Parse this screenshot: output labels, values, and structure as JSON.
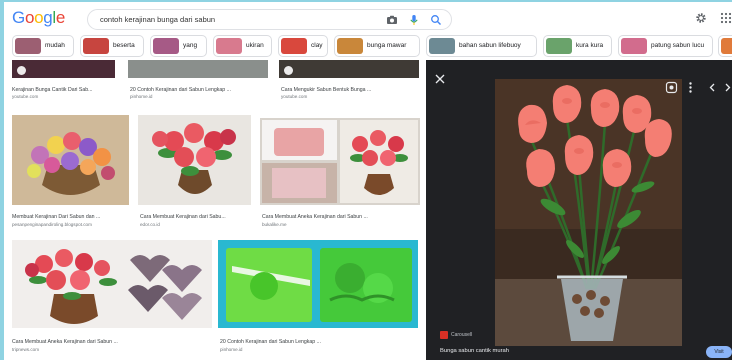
{
  "header": {
    "logo_letters": [
      {
        "ch": "G",
        "color": "#4285f4"
      },
      {
        "ch": "o",
        "color": "#ea4335"
      },
      {
        "ch": "o",
        "color": "#fbbc05"
      },
      {
        "ch": "g",
        "color": "#4285f4"
      },
      {
        "ch": "l",
        "color": "#34a853"
      },
      {
        "ch": "e",
        "color": "#ea4335"
      }
    ],
    "search_value": "contoh kerajinan bunga dari sabun",
    "icons": [
      "camera-icon",
      "mic-icon",
      "search-icon",
      "gear-icon",
      "apps-icon"
    ]
  },
  "chips": [
    {
      "label": "mudah",
      "color": "#9c5f72"
    },
    {
      "label": "beserta",
      "color": "#c7453f"
    },
    {
      "label": "yang",
      "color": "#a65a86"
    },
    {
      "label": "ukiran",
      "color": "#d87a8e"
    },
    {
      "label": "clay",
      "color": "#d9483d"
    },
    {
      "label": "bunga mawar",
      "color": "#c9873a"
    },
    {
      "label": "bahan sabun lifebuoy",
      "color": "#6d8a94"
    },
    {
      "label": "kura kura",
      "color": "#6aa36b"
    },
    {
      "label": "patung sabun lucu",
      "color": "#d26c8d"
    },
    {
      "label": "",
      "color": "#e07a3a"
    }
  ],
  "results": [
    {
      "title": "Kerajinan Bunga Cantik Dari Sab...",
      "source": "youtube.com"
    },
    {
      "title": "20 Contoh Kerajinan dari Sabun Lengkap ...",
      "source": "pinhome.id"
    },
    {
      "title": "Cara Mengukir Sabun Bentuk Bunga ...",
      "source": "youtube.com"
    },
    {
      "title": "Membuat Kerajinan Dari Sabun dan ...",
      "source": "pesanpenginapandiroling.blogspot.com"
    },
    {
      "title": "Cara Membuat Kerajinan dari Sabu...",
      "source": "edor.co.id"
    },
    {
      "title": "Cara Membuat Aneka Kerajinan dari Sabun ...",
      "source": "bukalike.me"
    },
    {
      "title": "Cara Membuat Aneka Kerajinan dari Sabun ...",
      "source": "tripnews.com"
    },
    {
      "title": "20 Contoh Kerajinan dari Sabun Lengkap ...",
      "source": "pinhome.id"
    }
  ],
  "viewer": {
    "source": "Carousell",
    "title": "Bunga sabun cantik murah",
    "visit": "Visit"
  }
}
